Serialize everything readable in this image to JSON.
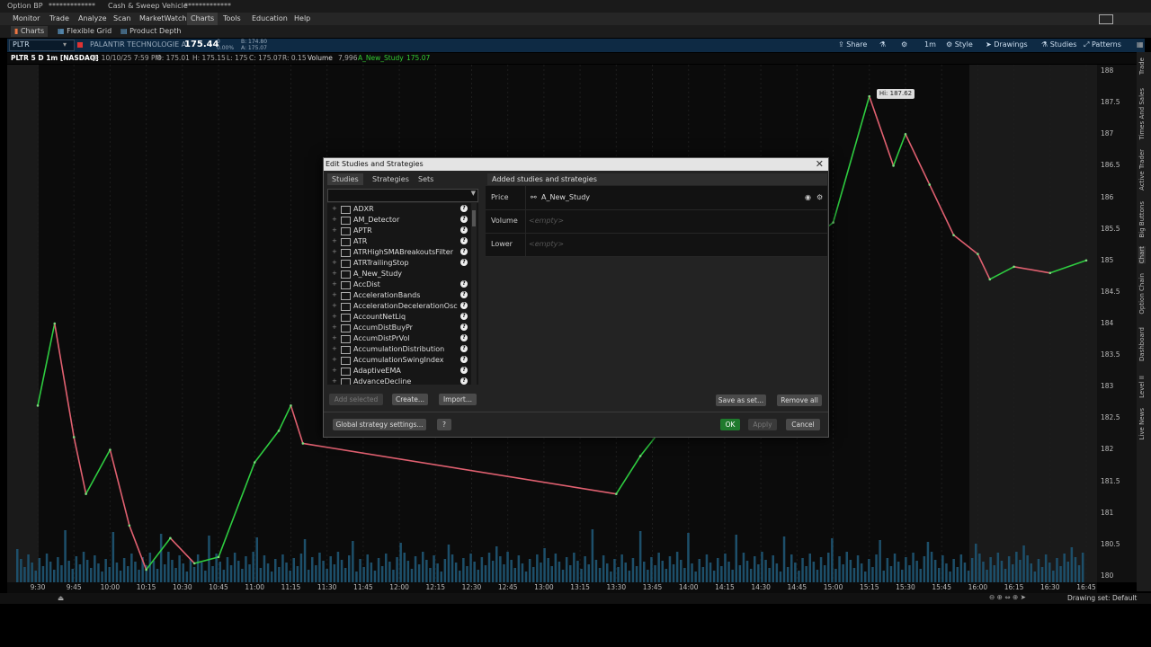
{
  "topbar": {
    "option_bp_label": "Option BP",
    "option_bp_value": "*************",
    "cash_sweep_label": "Cash & Sweep Vehicle",
    "cash_sweep_value": "*************"
  },
  "menu": {
    "items": [
      "Monitor",
      "Trade",
      "Analyze",
      "Scan",
      "MarketWatch",
      "Charts",
      "Tools",
      "Education",
      "Help"
    ],
    "active": "Charts"
  },
  "subtabs": [
    "Charts",
    "Flexible Grid",
    "Product Depth"
  ],
  "chart_header": {
    "symbol": "PLTR",
    "company": "PALANTIR TECHNOLOGIE A",
    "last_price": "175.44",
    "change": "0",
    "change_pct": "0.00%",
    "bid": "B: 174.80",
    "ask": "A: 175.07",
    "tools": [
      "Share",
      "1m",
      "Style",
      "Drawings",
      "Studies",
      "Patterns"
    ]
  },
  "info_line": {
    "title": "PLTR 5 D 1m [NASDAQ]",
    "date": "D: 10/10/25 7:59 PM",
    "open": "O: 175.01",
    "high": "H: 175.15",
    "low": "L: 175",
    "close": "C: 175.07",
    "range": "R: 0.15",
    "volume_label": "Volume",
    "volume_value": "7,996",
    "study_label": "A_New_Study",
    "study_value": "175.07"
  },
  "chart_data": {
    "type": "line",
    "y_ticks": [
      "188",
      "187.5",
      "187",
      "186.5",
      "186",
      "185.5",
      "185",
      "184.5",
      "184",
      "183.5",
      "183",
      "182.5",
      "182",
      "181.5",
      "181",
      "180.5",
      "180"
    ],
    "x_ticks": [
      "9:30",
      "9:45",
      "10:00",
      "10:15",
      "10:30",
      "10:45",
      "11:00",
      "11:15",
      "11:30",
      "11:45",
      "12:00",
      "12:15",
      "12:30",
      "12:45",
      "13:00",
      "13:15",
      "13:30",
      "13:45",
      "14:00",
      "14:15",
      "14:30",
      "14:45",
      "15:00",
      "15:15",
      "15:30",
      "15:45",
      "16:00",
      "16:15",
      "16:30",
      "16:45"
    ],
    "ylim": [
      179.9,
      188.1
    ],
    "high_marker": "Hi: 187.62",
    "price_points": [
      [
        "9:30",
        182.7
      ],
      [
        "9:37",
        184.0
      ],
      [
        "9:45",
        182.2
      ],
      [
        "9:50",
        181.3
      ],
      [
        "10:00",
        182.0
      ],
      [
        "10:08",
        180.8
      ],
      [
        "10:15",
        180.1
      ],
      [
        "10:25",
        180.6
      ],
      [
        "10:35",
        180.2
      ],
      [
        "10:45",
        180.3
      ],
      [
        "11:00",
        181.8
      ],
      [
        "11:10",
        182.3
      ],
      [
        "11:15",
        182.7
      ],
      [
        "11:20",
        182.1
      ],
      [
        "13:30",
        181.3
      ],
      [
        "13:40",
        181.9
      ],
      [
        "14:50",
        185.3
      ],
      [
        "15:00",
        185.6
      ],
      [
        "15:15",
        187.6
      ],
      [
        "15:25",
        186.5
      ],
      [
        "15:30",
        187.0
      ],
      [
        "15:40",
        186.2
      ],
      [
        "15:50",
        185.4
      ],
      [
        "16:00",
        185.1
      ],
      [
        "16:05",
        184.7
      ],
      [
        "16:15",
        184.9
      ],
      [
        "16:30",
        184.8
      ],
      [
        "16:45",
        185.0
      ]
    ]
  },
  "bottom": {
    "drawing_set": "Drawing set: Default"
  },
  "right_rail": [
    "Trade",
    "Times And Sales",
    "Active Trader",
    "Big Buttons",
    "Chart",
    "Option Chain",
    "Dashboard",
    "Level II",
    "Live News"
  ],
  "dialog": {
    "title": "Edit Studies and Strategies",
    "tabs": [
      "Studies",
      "Strategies",
      "Sets"
    ],
    "active_tab": "Studies",
    "studies": [
      "ADXR",
      "AM_Detector",
      "APTR",
      "ATR",
      "ATRHighSMABreakoutsFilter",
      "ATRTrailingStop",
      "A_New_Study",
      "AccDist",
      "AccelerationBands",
      "AccelerationDecelerationOsc",
      "AccountNetLiq",
      "AccumDistBuyPr",
      "AccumDistPrVol",
      "AccumulationDistribution",
      "AccumulationSwingIndex",
      "AdaptiveEMA",
      "AdvanceDecline"
    ],
    "added_header": "Added studies and strategies",
    "added_rows": [
      {
        "label": "Price",
        "value": "A_New_Study"
      },
      {
        "label": "Volume",
        "value": "<empty>"
      },
      {
        "label": "Lower",
        "value": "<empty>"
      }
    ],
    "buttons": {
      "add_selected": "Add selected",
      "create": "Create...",
      "import": "Import...",
      "save_as_set": "Save as set...",
      "remove_all": "Remove all",
      "global_strategy": "Global strategy settings...",
      "ok": "OK",
      "apply": "Apply",
      "cancel": "Cancel"
    }
  }
}
